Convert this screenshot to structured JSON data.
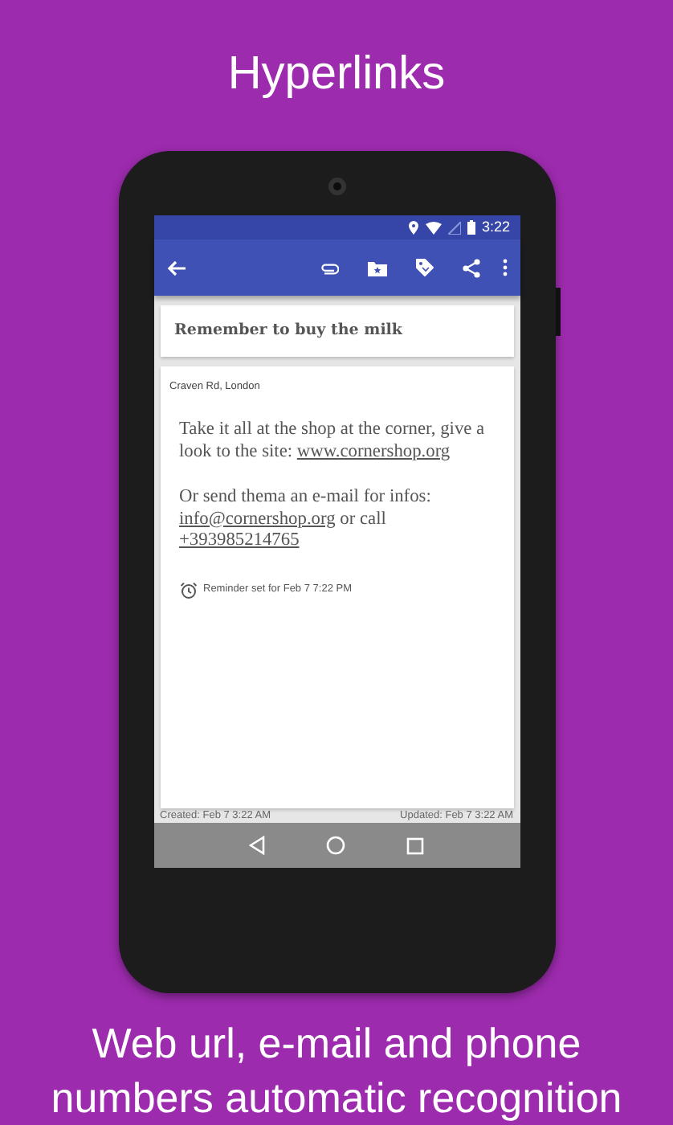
{
  "header": {
    "title": "Hyperlinks"
  },
  "status_bar": {
    "time": "3:22"
  },
  "note": {
    "title": "Remember to buy the milk",
    "location": "Craven Rd, London",
    "paragraphs": [
      [
        {
          "kind": "text",
          "text": "Take it all at the shop at the corner, give a look to the site: "
        },
        {
          "kind": "link",
          "text": "www.cornershop.org"
        }
      ],
      [
        {
          "kind": "text",
          "text": "Or send thema an e-mail for infos: "
        },
        {
          "kind": "link",
          "text": "info@cornershop.org"
        },
        {
          "kind": "text",
          "text": " or call "
        },
        {
          "kind": "link",
          "text": "+393985214765"
        }
      ]
    ],
    "reminder": "Reminder set for Feb 7 7:22 PM"
  },
  "footer": {
    "created": "Created: Feb 7 3:22 AM",
    "updated": "Updated: Feb 7 3:22 AM"
  },
  "caption": "Web url, e-mail and phone numbers automatic recognition"
}
